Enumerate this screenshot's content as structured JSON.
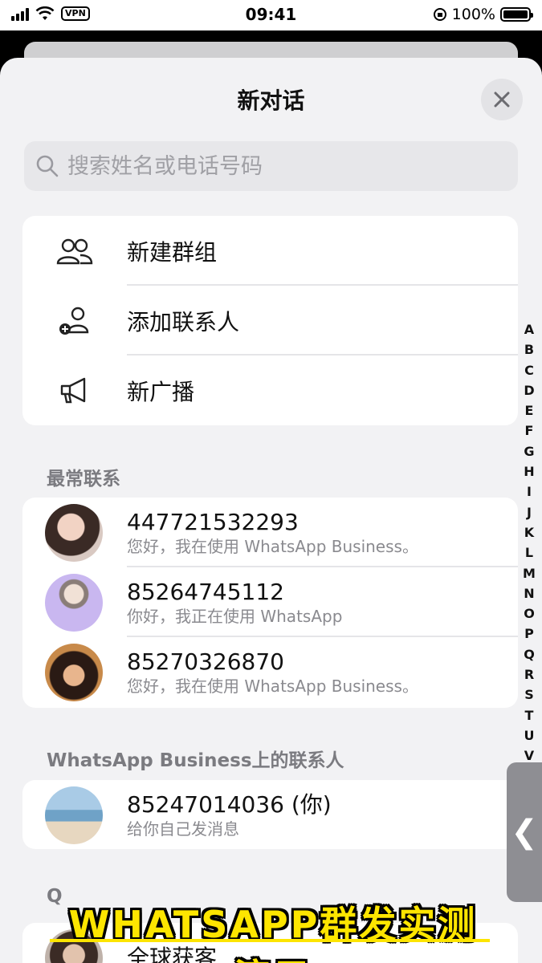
{
  "status_bar": {
    "time": "09:41",
    "vpn": "VPN",
    "battery_percent": "100%"
  },
  "sheet": {
    "title": "新对话",
    "close_icon": "close-icon"
  },
  "search": {
    "placeholder": "搜索姓名或电话号码",
    "icon": "search-icon"
  },
  "actions": [
    {
      "label": "新建群组",
      "icon": "group-icon"
    },
    {
      "label": "添加联系人",
      "icon": "add-contact-icon"
    },
    {
      "label": "新广播",
      "icon": "megaphone-icon"
    }
  ],
  "sections": {
    "frequent": "最常联系",
    "business_contacts": "WhatsApp Business上的联系人",
    "q_letter": "Q"
  },
  "frequent_contacts": [
    {
      "name": "447721532293",
      "status": "您好，我在使用 WhatsApp Business。"
    },
    {
      "name": "85264745112",
      "status": "你好，我正在使用 WhatsApp"
    },
    {
      "name": "85270326870",
      "status": "您好，我在使用 WhatsApp Business。"
    }
  ],
  "business_contacts": [
    {
      "name": "85247014036 (你)",
      "status": "给你自己发消息"
    }
  ],
  "q_contacts": [
    {
      "name": "全球获客"
    }
  ],
  "alphabet_index": [
    "A",
    "B",
    "C",
    "D",
    "E",
    "F",
    "G",
    "H",
    "I",
    "J",
    "K",
    "L",
    "M",
    "N",
    "O",
    "P",
    "Q",
    "R",
    "S",
    "T",
    "U",
    "V"
  ],
  "side_handle_glyph": "❮",
  "caption": "WHATSAPP群发实测演示"
}
